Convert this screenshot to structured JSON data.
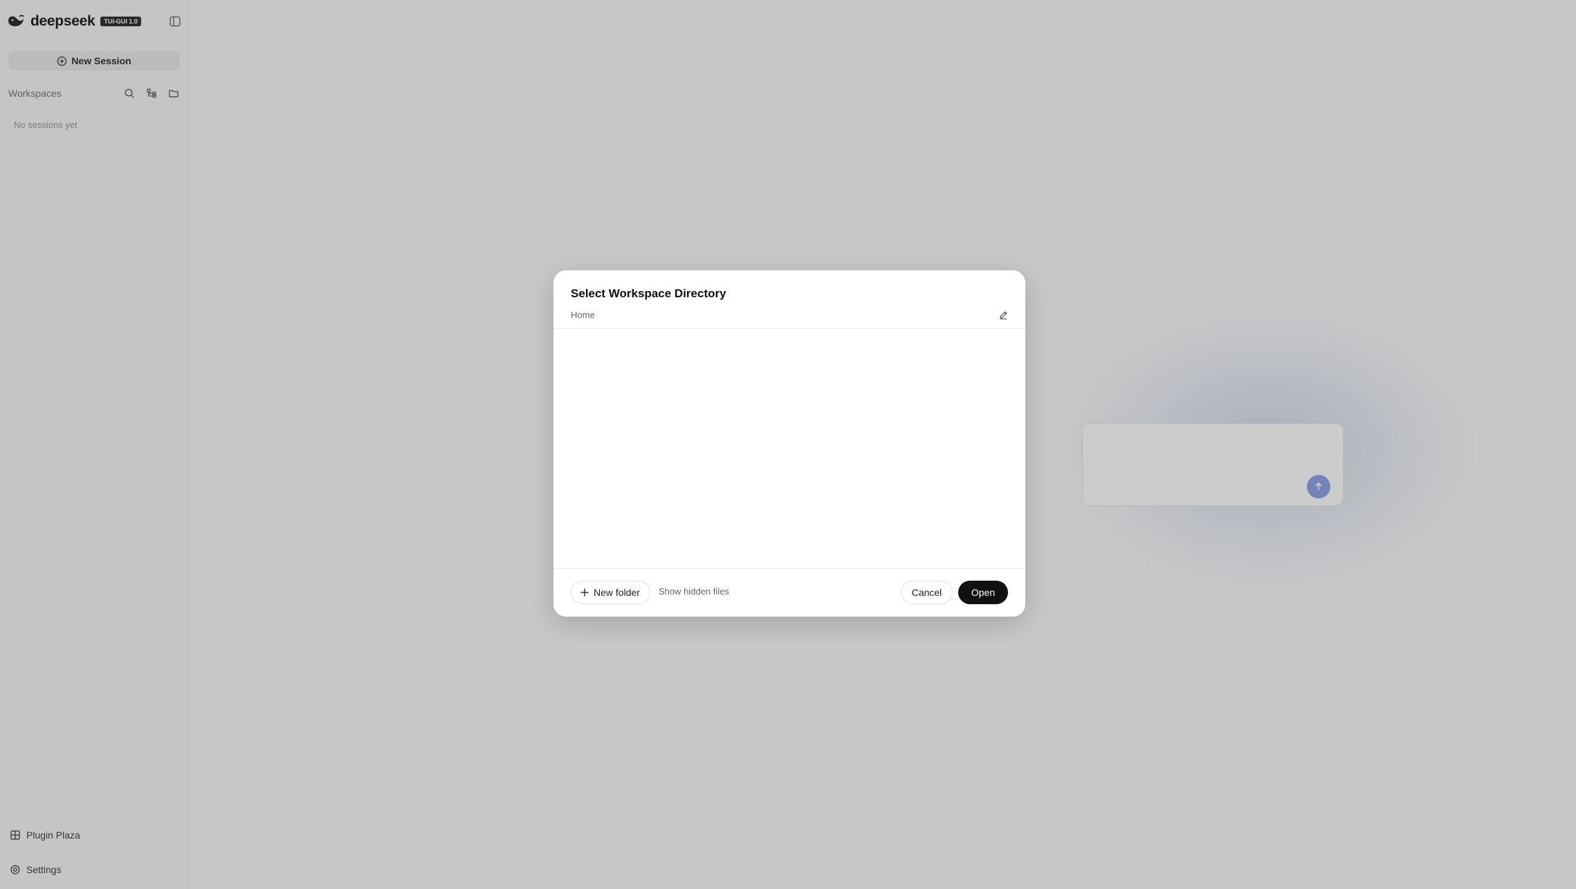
{
  "sidebar": {
    "brand": "deepseek",
    "badge": "TUI-GUI 1.0",
    "new_session_label": "New Session",
    "workspaces_title": "Workspaces",
    "empty_text": "No sessions yet",
    "plugin_label": "Plugin Plaza",
    "settings_label": "Settings"
  },
  "dialog": {
    "title": "Select Workspace Directory",
    "path": "Home",
    "new_folder_label": "New folder",
    "hidden_files_label": "Show hidden files",
    "cancel_label": "Cancel",
    "open_label": "Open"
  },
  "colors": {
    "accent": "#8fa6ea",
    "primary_button": "#111111",
    "overlay": "rgba(0,0,0,0.2)"
  },
  "icons": {
    "logo": "whale-logo-icon",
    "sidebar_toggle": "sidebar-toggle-icon",
    "new_session": "plus-circle-icon",
    "search": "search-icon",
    "tree": "tree-view-icon",
    "folder": "folder-icon",
    "plugin": "grid-icon",
    "settings": "gear-icon",
    "edit": "pencil-icon",
    "send": "arrow-up-icon",
    "add": "plus-icon"
  }
}
